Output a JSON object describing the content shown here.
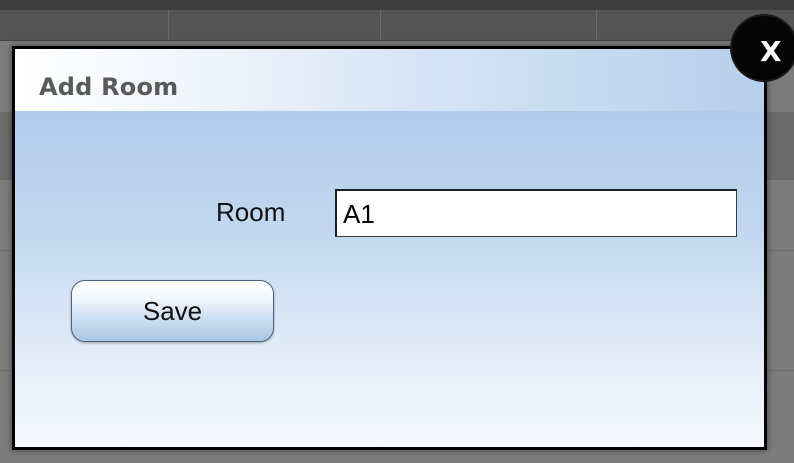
{
  "dialog": {
    "title": "Add Room",
    "close_label": "X",
    "room_label": "Room",
    "room_value": "A1",
    "save_label": "Save"
  },
  "colors": {
    "dialog_border": "#000000",
    "dialog_gradient_top": "#a9c6e8",
    "dialog_gradient_bottom": "#f6f9fd",
    "close_button_bg": "#050505",
    "overlay_bg": "#7c7c7c"
  },
  "icons": {
    "close": "close-icon"
  }
}
